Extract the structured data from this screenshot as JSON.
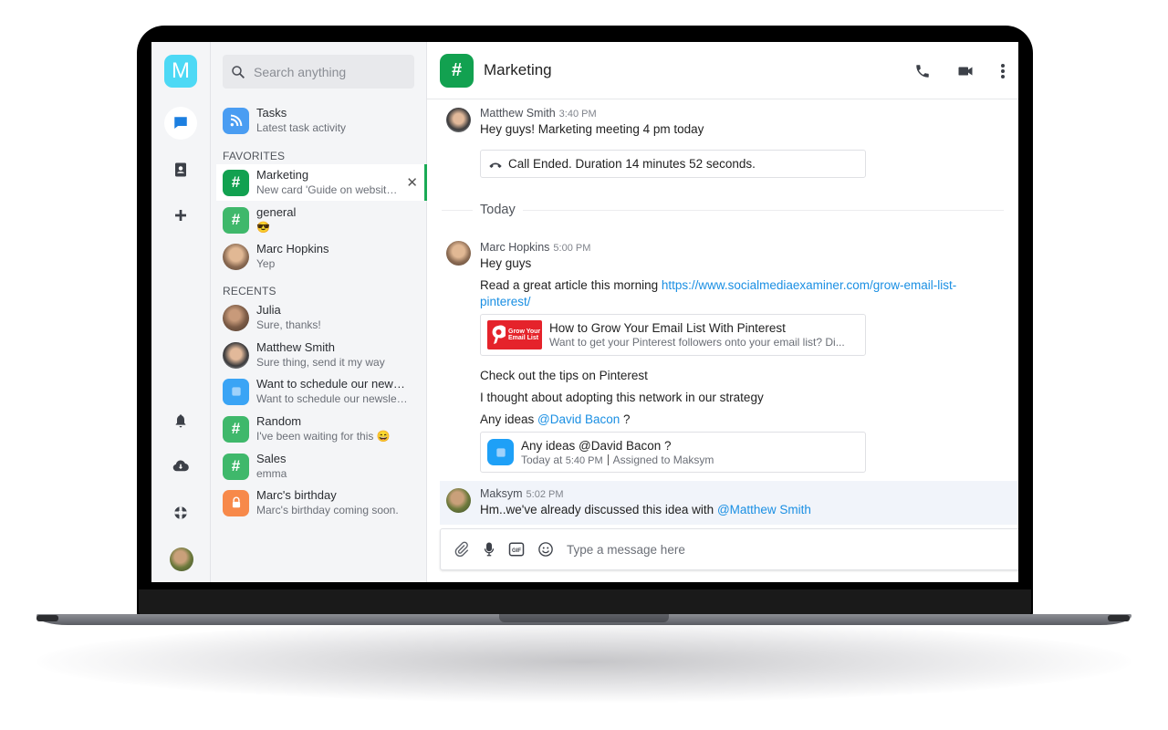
{
  "rail": {
    "logo_letter": "M",
    "items": [
      {
        "name": "chat",
        "icon": "chat-bubble-icon",
        "active": true
      },
      {
        "name": "contacts",
        "icon": "contacts-book-icon",
        "active": false
      },
      {
        "name": "add",
        "icon": "plus-icon",
        "active": false
      }
    ],
    "bottom_items": [
      {
        "name": "notifications",
        "icon": "bell-icon"
      },
      {
        "name": "download",
        "icon": "cloud-download-icon"
      },
      {
        "name": "help",
        "icon": "lifebuoy-icon"
      }
    ]
  },
  "sidebar": {
    "search_placeholder": "Search anything",
    "tasks": {
      "title": "Tasks",
      "subtitle": "Latest task activity",
      "color": "#4a9df2"
    },
    "favorites_label": "FAVORITES",
    "favorites": [
      {
        "title": "Marketing",
        "subtitle": "New card 'Guide on website optimization'",
        "type": "channel",
        "color": "#12a150",
        "active": true
      },
      {
        "title": "general",
        "subtitle": "😎",
        "type": "channel",
        "color": "#3fb86b",
        "active": false
      },
      {
        "title": "Marc Hopkins",
        "subtitle": "Yep",
        "type": "user",
        "active": false
      }
    ],
    "recents_label": "RECENTS",
    "recents": [
      {
        "title": "Julia",
        "subtitle": "Sure, thanks!",
        "type": "user"
      },
      {
        "title": "Matthew Smith",
        "subtitle": "Sure thing, send it my way",
        "type": "user"
      },
      {
        "title": "Want to schedule our newsletter",
        "subtitle": "Want to schedule our newsletter",
        "type": "task",
        "color": "#3aa4f5"
      },
      {
        "title": "Random",
        "subtitle": "I've been waiting for this 😄",
        "type": "channel",
        "color": "#3fb86b"
      },
      {
        "title": "Sales",
        "subtitle": "emma",
        "type": "channel",
        "color": "#3fb86b"
      },
      {
        "title": "Marc's birthday",
        "subtitle": "Marc's birthday coming soon.",
        "type": "private",
        "color": "#f7894a"
      }
    ]
  },
  "channel": {
    "title": "Marketing",
    "color": "#12a150",
    "actions": [
      "phone-icon",
      "video-camera-icon",
      "more-vertical-icon"
    ]
  },
  "messages": {
    "m1": {
      "author": "Matthew Smith",
      "time": "3:40 PM",
      "text": "Hey guys! Marketing meeting 4 pm today"
    },
    "call_card": "Call Ended. Duration 14 minutes 52 seconds.",
    "date_divider": "Today",
    "m2": {
      "author": "Marc Hopkins",
      "time": "5:00 PM",
      "line1": "Hey guys",
      "line2_prefix": "Read a great article this morning ",
      "line2_link_a": "https://www.socialmediaexaminer.com/grow-email-list-",
      "line2_link_b": "pinterest/",
      "preview_title": "How to Grow Your Email List With Pinterest",
      "preview_desc": "Want to get your Pinterest followers onto your email list? Di...",
      "line3": "Check out the tips on Pinterest",
      "line4": "I thought about adopting this network in our strategy",
      "line5_prefix": "Any ideas ",
      "line5_mention": "@David Bacon",
      "line5_suffix": " ?",
      "task_title": "Any ideas @David Bacon ?",
      "task_meta_prefix": "Today at ",
      "task_time": "5:40 PM",
      "task_assigned": "Assigned to  Maksym"
    },
    "m3": {
      "author": "Maksym",
      "time": "5:02 PM",
      "text_prefix": "Hm..we've already discussed this idea with ",
      "mention": "@Matthew Smith"
    }
  },
  "composer": {
    "placeholder": "Type a message here",
    "tools": [
      "paperclip-icon",
      "microphone-icon",
      "gif-icon",
      "emoji-icon"
    ]
  }
}
